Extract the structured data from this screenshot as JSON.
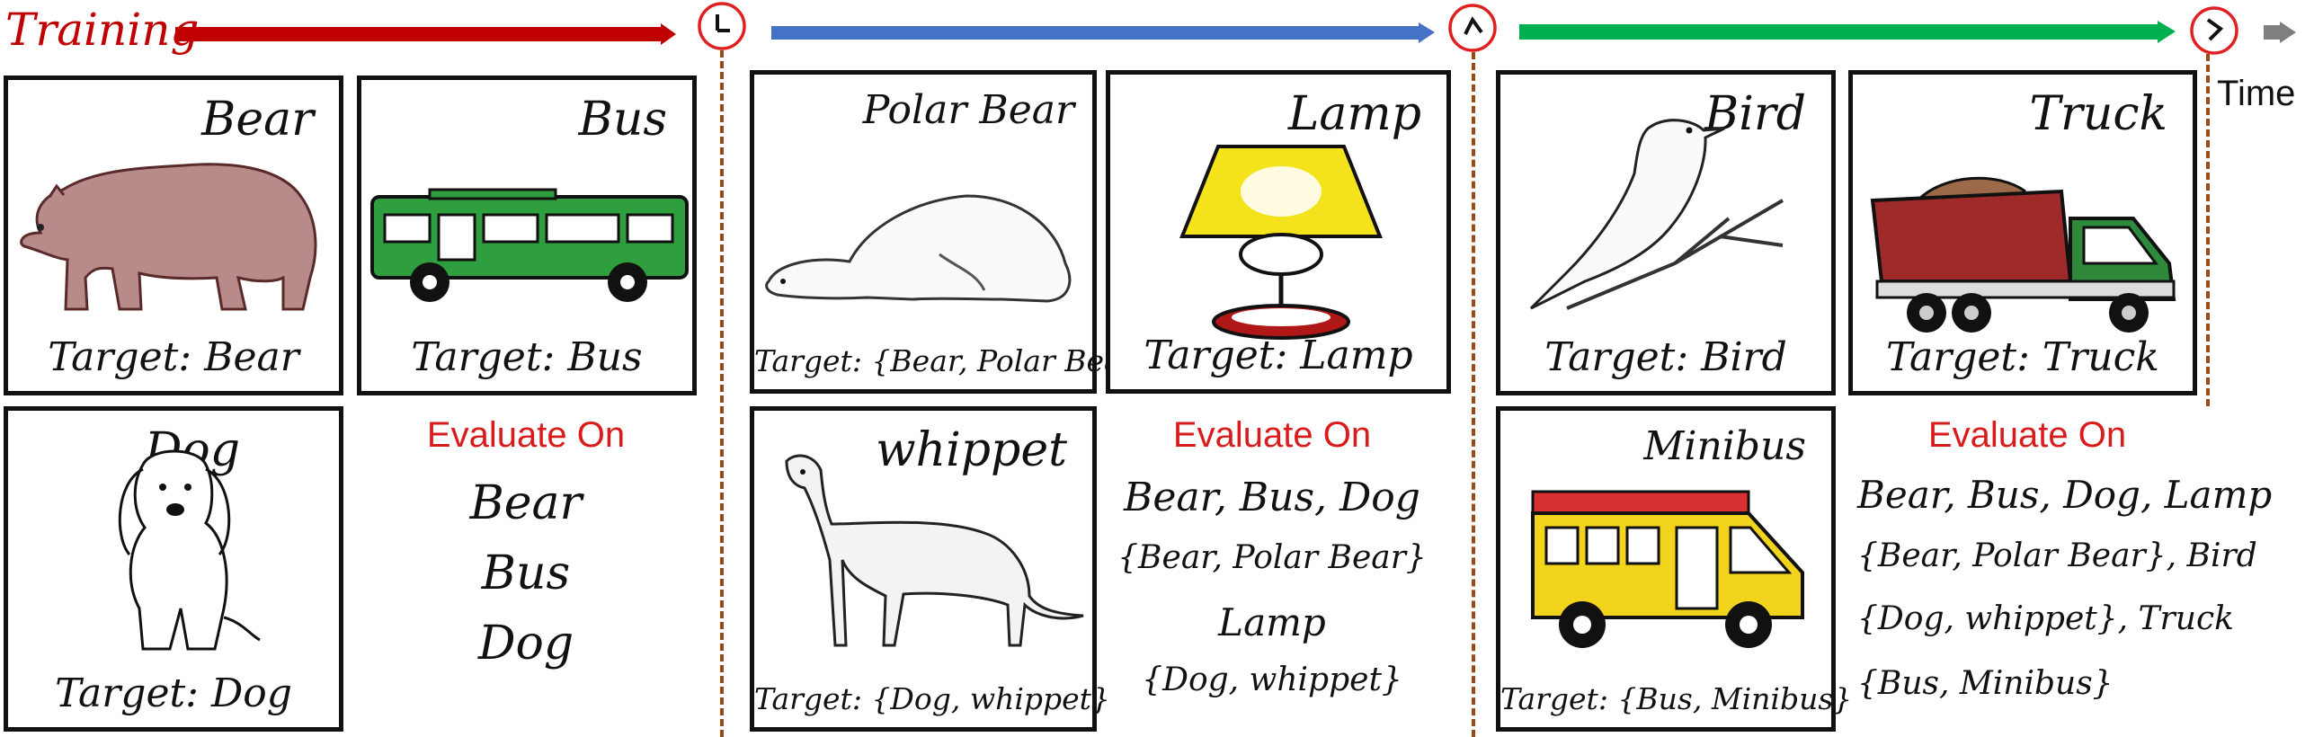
{
  "header": {
    "training_label": "Training",
    "time_label": "Time"
  },
  "colors": {
    "stage1_arrow": "#c00000",
    "stage2_arrow": "#4472c4",
    "stage3_arrow": "#00b050",
    "time_arrow": "#7f7f7f",
    "clock": "#e02020",
    "divider": "#9a4a16",
    "eval_title": "#d81b1b"
  },
  "stages": [
    {
      "cards": [
        {
          "title": "Bear",
          "target": "Target: Bear",
          "icon": "bear-icon"
        },
        {
          "title": "Bus",
          "target": "Target: Bus",
          "icon": "bus-icon"
        },
        {
          "title": "Dog",
          "target": "Target: Dog",
          "icon": "dog-icon"
        }
      ],
      "evaluate_title": "Evaluate On",
      "evaluate_lines": [
        "Bear",
        "Bus",
        "Dog"
      ]
    },
    {
      "cards": [
        {
          "title": "Polar Bear",
          "target": "Target: {Bear, Polar Bear}",
          "icon": "polar-bear-icon"
        },
        {
          "title": "Lamp",
          "target": "Target: Lamp",
          "icon": "lamp-icon"
        },
        {
          "title": "whippet",
          "target": "Target: {Dog, whippet}",
          "icon": "whippet-icon"
        }
      ],
      "evaluate_title": "Evaluate On",
      "evaluate_lines": [
        "Bear, Bus, Dog",
        "{Bear, Polar Bear}",
        "Lamp",
        "{Dog, whippet}"
      ]
    },
    {
      "cards": [
        {
          "title": "Bird",
          "target": "Target: Bird",
          "icon": "bird-icon"
        },
        {
          "title": "Truck",
          "target": "Target: Truck",
          "icon": "truck-icon"
        },
        {
          "title": "Minibus",
          "target": "Target: {Bus, Minibus}",
          "icon": "minibus-icon"
        }
      ],
      "evaluate_title": "Evaluate On",
      "evaluate_lines": [
        "Bear, Bus, Dog, Lamp",
        "{Bear, Polar Bear}, Bird",
        "{Dog, whippet}, Truck",
        "{Bus, Minibus}"
      ]
    }
  ]
}
